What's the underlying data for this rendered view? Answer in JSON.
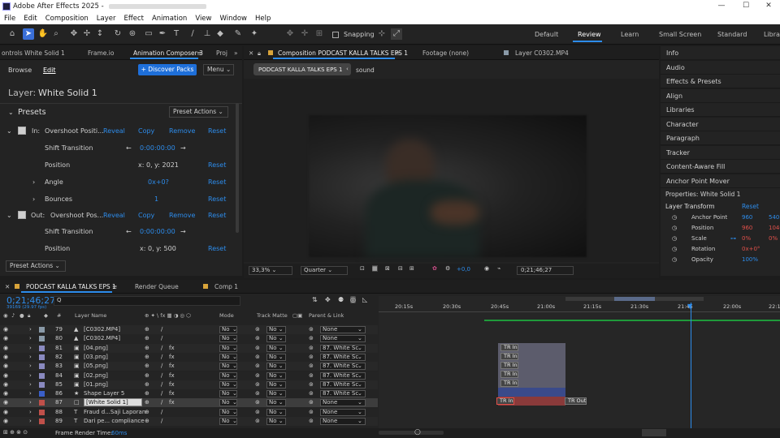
{
  "title_bar": {
    "title": "Adobe After Effects 2025 -"
  },
  "menu": [
    "File",
    "Edit",
    "Composition",
    "Layer",
    "Effect",
    "Animation",
    "View",
    "Window",
    "Help"
  ],
  "toolbar": {
    "snapping_label": "Snapping",
    "workspaces": [
      "Default",
      "Review",
      "Learn",
      "Small Screen",
      "Standard",
      "Librar"
    ],
    "active_workspace": "Review"
  },
  "left_panel": {
    "tabs": [
      "ontrols White Solid 1",
      "Frame.io",
      "Animation Composer 3",
      "Proj"
    ],
    "active_tab": "Animation Composer 3",
    "sub_tabs": [
      "Browse",
      "Edit"
    ],
    "discover_label": "+ Discover Packs",
    "menu_label": "Menu",
    "layer_label": "Layer:",
    "layer_name": "White Solid 1",
    "presets_label": "Presets",
    "preset_actions_label": "Preset Actions",
    "in_row": {
      "label": "In:",
      "preset": "Overshoot Positi...",
      "reveal": "Reveal",
      "copy": "Copy",
      "remove": "Remove",
      "reset": "Reset"
    },
    "in_props": [
      {
        "name": "Shift Transition",
        "value": "0:00:00:00"
      },
      {
        "name": "Position",
        "value": "x: 0, y: 2021",
        "reset": "Reset"
      },
      {
        "name": "Angle",
        "value": "0x+0?",
        "reset": "Reset"
      },
      {
        "name": "Bounces",
        "value": "1",
        "reset": "Reset"
      }
    ],
    "out_row": {
      "label": "Out:",
      "preset": "Overshoot Pos...",
      "reveal": "Reveal",
      "copy": "Copy",
      "remove": "Remove",
      "reset": "Reset"
    },
    "out_props": [
      {
        "name": "Shift Transition",
        "value": "0:00:00:00"
      },
      {
        "name": "Position",
        "value": "x: 0, y: 500",
        "reset": "Reset"
      }
    ],
    "bottom_button": "Preset Actions"
  },
  "viewer": {
    "tabs": [
      "Composition PODCAST KALLA TALKS EPS 1",
      "Footage (none)",
      "Layer C0302.MP4"
    ],
    "breadcrumb": [
      "PODCAST KALLA TALKS EPS 1",
      "sound"
    ],
    "zoom": "33,3%",
    "resolution": "Quarter",
    "exposure": "+0,0",
    "timecode": "0;21;46;27"
  },
  "right_panel": {
    "items": [
      "Info",
      "Audio",
      "Effects & Presets",
      "Align",
      "Libraries",
      "Character",
      "Paragraph",
      "Tracker",
      "Content-Aware Fill",
      "Anchor Point Mover"
    ],
    "properties_title": "Properties: White Solid 1",
    "layer_transform": "Layer Transform",
    "reset_label": "Reset",
    "props": [
      {
        "name": "Anchor Point",
        "v1": "960",
        "v2": "540"
      },
      {
        "name": "Position",
        "v1": "960",
        "v2": "1040"
      },
      {
        "name": "Scale",
        "v1": "0%",
        "v2": "0%"
      },
      {
        "name": "Rotation",
        "v1": "0x+0°",
        "v2": ""
      },
      {
        "name": "Opacity",
        "v1": "100%",
        "v2": ""
      }
    ]
  },
  "timeline": {
    "tabs": [
      "PODCAST KALLA TALKS EPS 1",
      "Render Queue",
      "Comp 1"
    ],
    "timecode": "0;21;46;27",
    "frame_sub": "39169 (29.97 fps)",
    "search_placeholder": "Q",
    "headers": {
      "layer_name": "Layer Name",
      "mode": "Mode",
      "track_matte": "Track Matte",
      "parent": "Parent & Link"
    },
    "ruler": [
      "20:15s",
      "20:30s",
      "20:45s",
      "21:00s",
      "21:15s",
      "21:30s",
      "21:45",
      "22:00s",
      "22:15"
    ],
    "layers": [
      {
        "num": "79",
        "color": "#8a9aa8",
        "name": "[C0302.MP4]",
        "mode": "No",
        "parent": "None",
        "icon": "▲"
      },
      {
        "num": "80",
        "color": "#8a9aa8",
        "name": "[C0302.MP4]",
        "mode": "No",
        "parent": "None",
        "icon": "▲"
      },
      {
        "num": "81",
        "color": "#8a8ac0",
        "name": "[04.png]",
        "mode": "No",
        "parent": "87. White Sc",
        "icon": "▣"
      },
      {
        "num": "82",
        "color": "#8a8ac0",
        "name": "[03.png]",
        "mode": "No",
        "parent": "87. White Sc",
        "icon": "▣"
      },
      {
        "num": "83",
        "color": "#8a8ac0",
        "name": "[05.png]",
        "mode": "No",
        "parent": "87. White Sc",
        "icon": "▣"
      },
      {
        "num": "84",
        "color": "#8a8ac0",
        "name": "[02.png]",
        "mode": "No",
        "parent": "87. White Sc",
        "icon": "▣"
      },
      {
        "num": "85",
        "color": "#8a8ac0",
        "name": "[01.png]",
        "mode": "No",
        "parent": "87. White Sc",
        "icon": "▣"
      },
      {
        "num": "86",
        "color": "#3a5fc8",
        "name": "Shape Layer 5",
        "mode": "No",
        "parent": "87. White Sc",
        "icon": "★"
      },
      {
        "num": "87",
        "color": "#c0504a",
        "name": "[White Solid 1]",
        "mode": "No",
        "parent": "None",
        "icon": "□"
      },
      {
        "num": "88",
        "color": "#c0504a",
        "name": "Fraud d...Saji Laporan",
        "mode": "No",
        "parent": "None",
        "icon": "T"
      },
      {
        "num": "89",
        "color": "#c0504a",
        "name": "Dari pe... compliance",
        "mode": "No",
        "parent": "None",
        "icon": "T"
      }
    ],
    "tr_in": "TR In",
    "tr_out": "TR Out",
    "render_time_label": "Frame Render Time:",
    "render_time": "60ms"
  }
}
